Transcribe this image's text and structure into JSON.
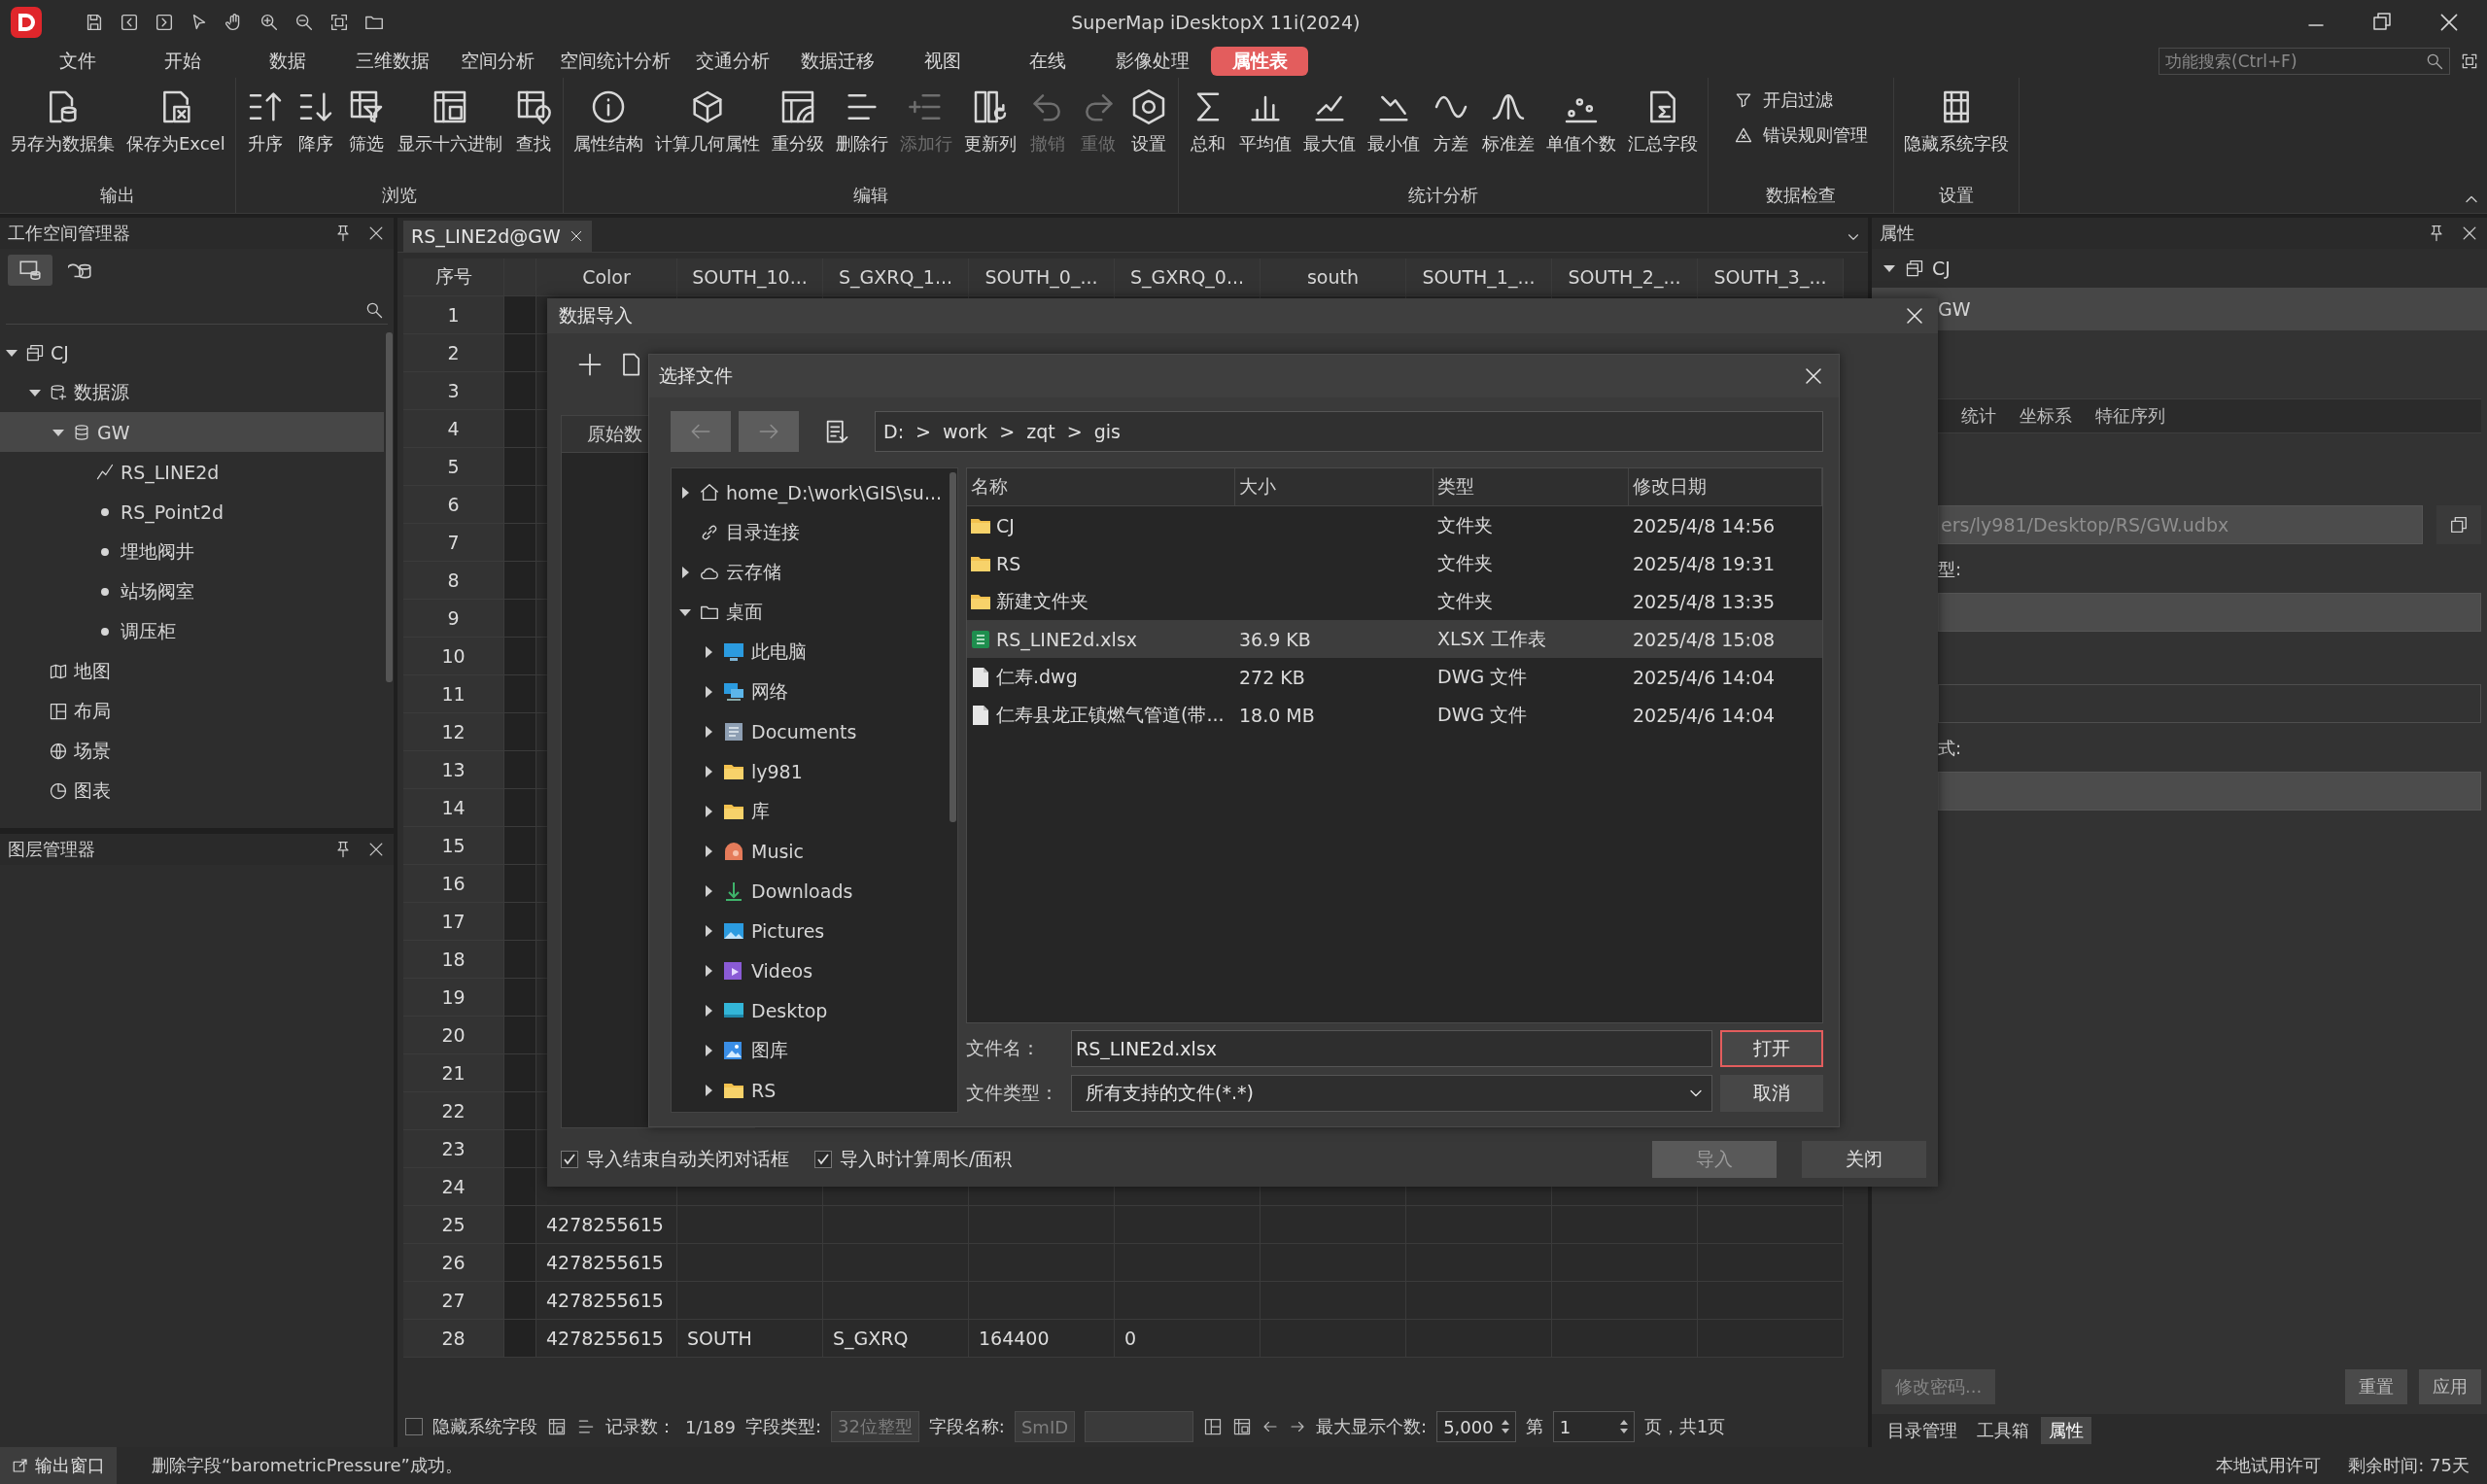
{
  "window": {
    "title": "SuperMap iDesktopX 11i(2024)"
  },
  "menu": [
    {
      "label": "文件",
      "selected": false
    },
    {
      "label": "开始",
      "selected": false
    },
    {
      "label": "数据",
      "selected": false
    },
    {
      "label": "三维数据",
      "selected": false
    },
    {
      "label": "空间分析",
      "selected": false
    },
    {
      "label": "空间统计分析",
      "selected": false
    },
    {
      "label": "交通分析",
      "selected": false
    },
    {
      "label": "数据迁移",
      "selected": false
    },
    {
      "label": "视图",
      "selected": false
    },
    {
      "label": "在线",
      "selected": false
    },
    {
      "label": "影像处理",
      "selected": false
    },
    {
      "label": "属性表",
      "selected": true
    }
  ],
  "search": {
    "placeholder": "功能搜索(Ctrl+F)"
  },
  "ribbon": [
    {
      "label": "输出",
      "kind": "large",
      "buttons": [
        {
          "label": "另存为数据集",
          "disabled": false
        },
        {
          "label": "保存为Excel",
          "disabled": false
        }
      ]
    },
    {
      "label": "浏览",
      "kind": "large",
      "buttons": [
        {
          "label": "升序",
          "disabled": false
        },
        {
          "label": "降序",
          "disabled": false
        },
        {
          "label": "筛选",
          "disabled": false
        },
        {
          "label": "显示十六进制",
          "disabled": false
        },
        {
          "label": "查找",
          "disabled": false
        }
      ]
    },
    {
      "label": "编辑",
      "kind": "large",
      "buttons": [
        {
          "label": "属性结构",
          "disabled": false
        },
        {
          "label": "计算几何属性",
          "disabled": false
        },
        {
          "label": "重分级",
          "disabled": false
        },
        {
          "label": "删除行",
          "disabled": false
        },
        {
          "label": "添加行",
          "disabled": true
        },
        {
          "label": "更新列",
          "disabled": false
        },
        {
          "label": "撤销",
          "disabled": true
        },
        {
          "label": "重做",
          "disabled": true
        },
        {
          "label": "设置",
          "disabled": false
        }
      ]
    },
    {
      "label": "统计分析",
      "kind": "large",
      "buttons": [
        {
          "label": "总和",
          "disabled": false
        },
        {
          "label": "平均值",
          "disabled": false
        },
        {
          "label": "最大值",
          "disabled": false
        },
        {
          "label": "最小值",
          "disabled": false
        },
        {
          "label": "方差",
          "disabled": false
        },
        {
          "label": "标准差",
          "disabled": false
        },
        {
          "label": "单值个数",
          "disabled": false
        },
        {
          "label": "汇总字段",
          "disabled": false
        }
      ]
    },
    {
      "label": "数据检查",
      "kind": "small",
      "buttons": [
        {
          "label": "开启过滤",
          "disabled": false
        },
        {
          "label": "错误规则管理",
          "disabled": false
        }
      ]
    },
    {
      "label": "设置",
      "kind": "large",
      "buttons": [
        {
          "label": "隐藏系统字段",
          "disabled": false
        }
      ]
    }
  ],
  "workspace_panel": {
    "title": "工作空间管理器",
    "view_tabs": [
      {
        "selected": true
      },
      {
        "selected": false
      }
    ],
    "tree": [
      {
        "label": "CJ",
        "kind": "workspace",
        "expanded": true,
        "selected": false,
        "children": [
          {
            "label": "数据源",
            "kind": "datasources",
            "expanded": true,
            "selected": false,
            "children": [
              {
                "label": "GW",
                "kind": "udbx",
                "expanded": true,
                "selected": true,
                "children": [
                  {
                    "label": "RS_LINE2d",
                    "kind": "line",
                    "selected": false
                  },
                  {
                    "label": "RS_Point2d",
                    "kind": "point",
                    "selected": false
                  },
                  {
                    "label": "埋地阀井",
                    "kind": "point",
                    "selected": false
                  },
                  {
                    "label": "站场阀室",
                    "kind": "point",
                    "selected": false
                  },
                  {
                    "label": "调压柜",
                    "kind": "point",
                    "selected": false
                  }
                ]
              }
            ]
          },
          {
            "label": "地图",
            "kind": "map",
            "selected": false
          },
          {
            "label": "布局",
            "kind": "layout",
            "selected": false
          },
          {
            "label": "场景",
            "kind": "scene",
            "selected": false
          },
          {
            "label": "图表",
            "kind": "chart",
            "selected": false
          }
        ]
      }
    ]
  },
  "layer_panel": {
    "title": "图层管理器"
  },
  "table": {
    "tab": "RS_LINE2d@GW",
    "row_header": "序号",
    "columns": [
      "Color",
      "SOUTH_10...",
      "S_GXRQ_1...",
      "SOUTH_0_...",
      "S_GXRQ_0...",
      "south",
      "SOUTH_1_...",
      "SOUTH_2_...",
      "SOUTH_3_..."
    ],
    "rows": [
      {
        "number": "1"
      },
      {
        "number": "2"
      },
      {
        "number": "3"
      },
      {
        "number": "4"
      },
      {
        "number": "5"
      },
      {
        "number": "6"
      },
      {
        "number": "7"
      },
      {
        "number": "8"
      },
      {
        "number": "9"
      },
      {
        "number": "10"
      },
      {
        "number": "11"
      },
      {
        "number": "12"
      },
      {
        "number": "13"
      },
      {
        "number": "14"
      },
      {
        "number": "15"
      },
      {
        "number": "16"
      },
      {
        "number": "17"
      },
      {
        "number": "18"
      },
      {
        "number": "19"
      },
      {
        "number": "20"
      },
      {
        "number": "21"
      },
      {
        "number": "22"
      },
      {
        "number": "23"
      },
      {
        "number": "24"
      },
      {
        "number": "25",
        "cells": [
          "4278255615"
        ]
      },
      {
        "number": "26",
        "cells": [
          "4278255615"
        ]
      },
      {
        "number": "27",
        "cells": [
          "4278255615"
        ]
      },
      {
        "number": "28",
        "cells": [
          "4278255615",
          "SOUTH",
          "S_GXRQ",
          "164400",
          "0"
        ]
      }
    ]
  },
  "table_toolbar": {
    "hide_system_fields": {
      "label": "隐藏系统字段",
      "checked": false
    },
    "records_label": "记录数：",
    "records": "1/189",
    "field_type_label": "字段类型:",
    "field_type": "32位整型",
    "field_name_label": "字段名称:",
    "field_name": "SmID",
    "max_label": "最大显示个数:",
    "max_value": "5,000",
    "page_label": "第",
    "page": "1",
    "page_suffix": "页，共1页"
  },
  "import_dialog": {
    "title": "数据导入",
    "source_tab": "原始数",
    "options": [
      {
        "label": "导入结束自动关闭对话框",
        "checked": true
      },
      {
        "label": "导入时计算周长/面积",
        "checked": true
      }
    ],
    "buttons": [
      {
        "label": "导入",
        "disabled": true
      },
      {
        "label": "关闭",
        "disabled": false
      }
    ],
    "file_dialog": {
      "title": "选择文件",
      "path": "D:  >  work  >  zqt  >  gis",
      "tree": [
        {
          "label": "home_D:\\work\\GIS\\su...",
          "kind": "home",
          "expanded": false
        },
        {
          "label": "目录连接",
          "kind": "link"
        },
        {
          "label": "云存储",
          "kind": "cloud",
          "expanded": false
        },
        {
          "label": "桌面",
          "kind": "folder-outline",
          "expanded": true,
          "children": [
            {
              "label": "此电脑",
              "kind": "pc",
              "expanded": false
            },
            {
              "label": "网络",
              "kind": "network",
              "expanded": false
            },
            {
              "label": "Documents",
              "kind": "documents",
              "expanded": false
            },
            {
              "label": "ly981",
              "kind": "folder",
              "expanded": false
            },
            {
              "label": "库",
              "kind": "folder",
              "expanded": false
            },
            {
              "label": "Music",
              "kind": "music",
              "expanded": false
            },
            {
              "label": "Downloads",
              "kind": "downloads",
              "expanded": false
            },
            {
              "label": "Pictures",
              "kind": "pictures",
              "expanded": false
            },
            {
              "label": "Videos",
              "kind": "videos",
              "expanded": false
            },
            {
              "label": "Desktop",
              "kind": "desktop",
              "expanded": false
            },
            {
              "label": "图库",
              "kind": "gallery",
              "expanded": false
            },
            {
              "label": "RS",
              "kind": "folder",
              "expanded": false
            }
          ]
        }
      ],
      "columns": [
        "名称",
        "大小",
        "类型",
        "修改日期"
      ],
      "files": [
        {
          "name": "CJ",
          "kind": "folder",
          "type": "文件夹",
          "modified": "2025/4/8 14:56",
          "selected": false
        },
        {
          "name": "RS",
          "kind": "folder",
          "type": "文件夹",
          "modified": "2025/4/8 19:31",
          "selected": false
        },
        {
          "name": "新建文件夹",
          "kind": "folder",
          "type": "文件夹",
          "modified": "2025/4/8 13:35",
          "selected": false
        },
        {
          "name": "RS_LINE2d.xlsx",
          "kind": "sheet",
          "size": "36.9 KB",
          "type": "XLSX 工作表",
          "modified": "2025/4/8 15:08",
          "selected": true
        },
        {
          "name": "仁寿.dwg",
          "kind": "drawing",
          "size": "272 KB",
          "type": "DWG 文件",
          "modified": "2025/4/6 14:04",
          "selected": false
        },
        {
          "name": "仁寿县龙正镇燃气管道(带...",
          "kind": "drawing",
          "size": "18.0 MB",
          "type": "DWG 文件",
          "modified": "2025/4/6 14:04",
          "selected": false
        }
      ],
      "file_name_label": "文件名：",
      "file_name": "RS_LINE2d.xlsx",
      "open": "打开",
      "file_type_label": "文件类型：",
      "file_type": "所有支持的文件(*.*)",
      "cancel": "取消"
    }
  },
  "properties_panel": {
    "title": "属性",
    "root": {
      "label": "CJ",
      "expanded": true
    },
    "item": "GW",
    "tabs": [
      {
        "label": "统计",
        "selected": false
      },
      {
        "label": "坐标系",
        "selected": false
      },
      {
        "label": "特征序列",
        "selected": false
      }
    ],
    "path": "ers/ly981/Desktop/RS/GW.udbx",
    "label_type": "型:",
    "label_format": "式:",
    "buttons": [
      {
        "label": "修改密码...",
        "disabled": true
      },
      {
        "label": "重置",
        "disabled": false
      },
      {
        "label": "应用",
        "disabled": false
      }
    ],
    "bottom_tabs": [
      {
        "label": "目录管理",
        "selected": false
      },
      {
        "label": "工具箱",
        "selected": false
      },
      {
        "label": "属性",
        "selected": true
      }
    ]
  },
  "status_bar": {
    "output": "输出窗口",
    "message": "删除字段“barometricPressure”成功。",
    "license": "本地试用许可",
    "remaining": "剩余时间: 75天"
  }
}
